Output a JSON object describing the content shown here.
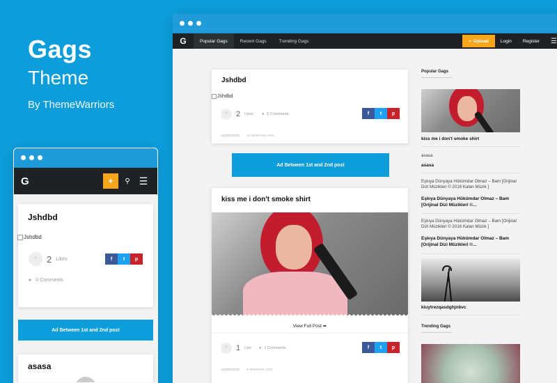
{
  "promo": {
    "brand": "Gags",
    "subtitle": "Theme",
    "byline": "By ThemeWarriors"
  },
  "desktop": {
    "nav": {
      "logo": "G",
      "tabs": [
        "Popular Gags",
        "Recent Gags",
        "Trending Gags"
      ],
      "active_tab": "Popular Gags",
      "upload_label": "Upload",
      "login_label": "Login",
      "register_label": "Register",
      "menu_icon": "menu-icon"
    },
    "posts": [
      {
        "title": "Jshdbd",
        "image_alt": "Jshdbd",
        "likes": "2",
        "likes_label": "Likes",
        "comments": "0 Comments",
        "author": "USERDEMO",
        "time": "12 MONTHS AGO"
      },
      {
        "title": "kiss me i don't smoke shirt",
        "view_full": "View Full Post",
        "likes": "1",
        "likes_label": "Like",
        "comments": "1 Comments",
        "author": "USERDEMO",
        "time": "6 MONTHS AGO"
      }
    ],
    "ad_label": "Ad Between 1st and 2nd post",
    "share": {
      "facebook": "f",
      "twitter": "t",
      "pinterest": "p"
    },
    "sidebar": {
      "popular_heading": "Popular Gags",
      "items": [
        {
          "title": "kiss me i don't smoke shirt"
        },
        {
          "image_alt": "asasa",
          "title": "asasa"
        },
        {
          "image_alt": "Eşkıya Dünyaya Hükümdar Olmaz – Bam [Orijinal Dizi Müzikleri © 2016 Kalan Müzik ]",
          "title": "Eşkıya Dünyaya Hükümdar Olmaz – Bam [Orijinal Dizi Müzikleri ©..."
        },
        {
          "image_alt": "Eşkıya Dünyaya Hükümdar Olmaz – Bam [Orijinal Dizi Müzikleri © 2016 Kalan Müzik ]",
          "title": "Eşkıya Dünyaya Hükümdar Olmaz – Bam [Orijinal Dizi Müzikleri ©..."
        },
        {
          "title": "kiuytrezqasdghjnbvc"
        }
      ],
      "trending_heading": "Trending Gags"
    }
  },
  "mobile": {
    "logo": "G",
    "plus": "+",
    "post": {
      "title": "Jshdbd",
      "image_alt": "Jshdbd",
      "likes": "2",
      "likes_label": "Likes",
      "comments": "0 Comments"
    },
    "ad_label": "Ad Between 1st and 2nd post",
    "next_title": "asasa"
  },
  "colors": {
    "background": "#0d9ddb",
    "nav_dark": "#1e2224",
    "upload_orange": "#f7a51d",
    "facebook": "#3b5998",
    "twitter": "#1da1f2",
    "pinterest": "#c92228"
  }
}
